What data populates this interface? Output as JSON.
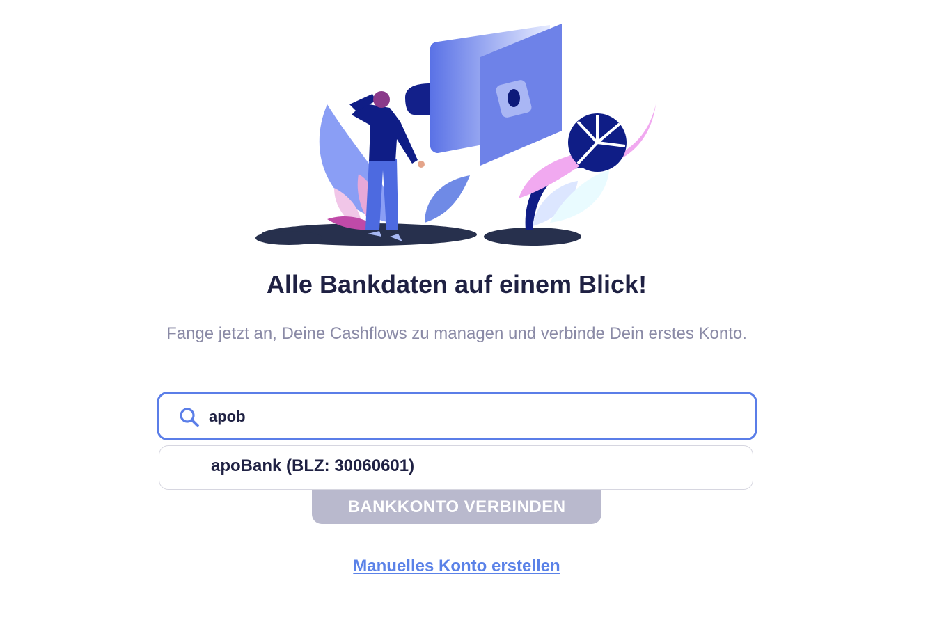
{
  "header": {
    "title": "Alle Bankdaten auf einem Blick!",
    "subtitle": "Fange jetzt an, Deine Cashflows zu managen und verbinde Dein erstes Konto."
  },
  "search": {
    "value": "apob",
    "icon": "search-icon"
  },
  "suggestions": [
    {
      "label": "apoBank (BLZ: 30060601)"
    }
  ],
  "actions": {
    "connect_label": "BANKKONTO VERBINDEN",
    "manual_link_label": "Manuelles Konto erstellen"
  },
  "colors": {
    "accent": "#5b7ee8",
    "title": "#1f2143",
    "muted": "#8a8aa6",
    "disabled_button": "#b9b9cd"
  }
}
